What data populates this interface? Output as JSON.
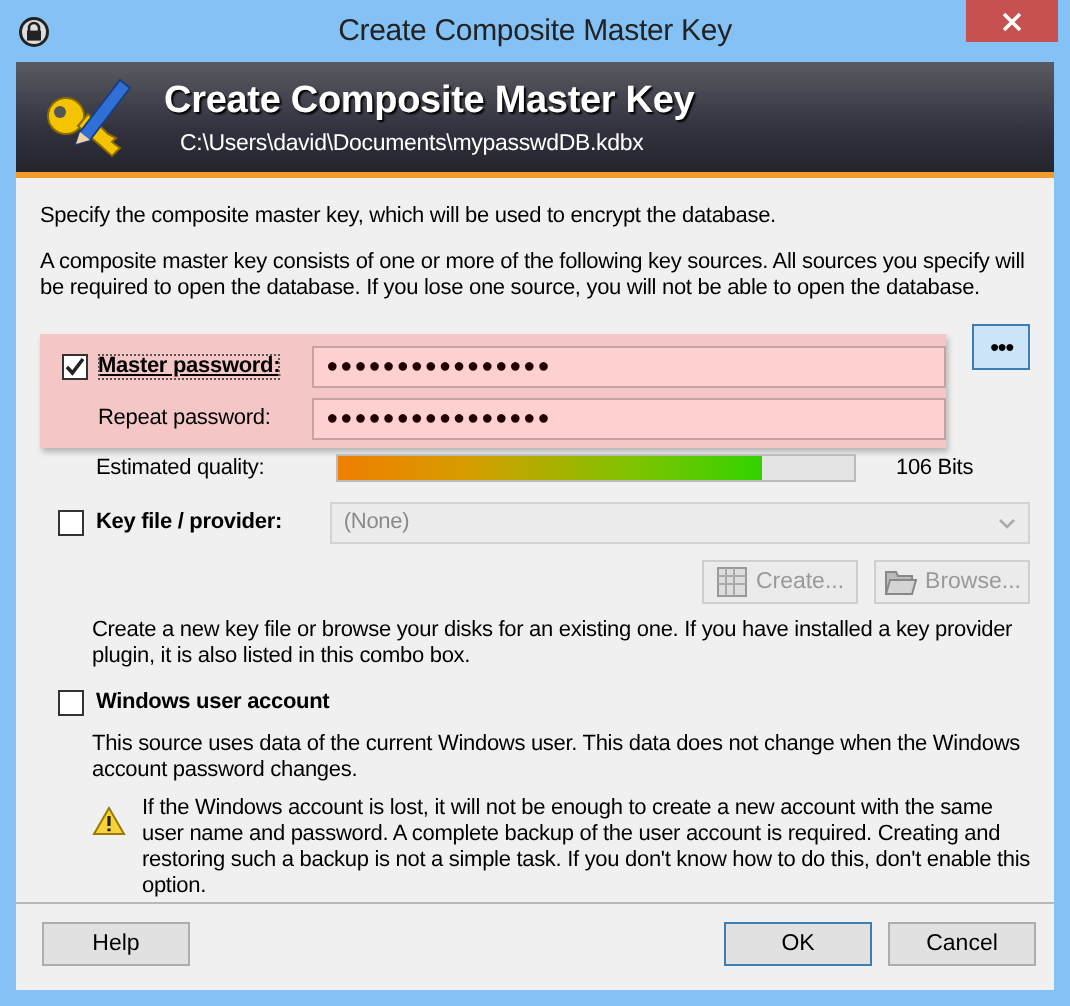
{
  "window": {
    "title": "Create Composite Master Key"
  },
  "banner": {
    "title": "Create Composite Master Key",
    "path": "C:\\Users\\david\\Documents\\mypasswdDB.kdbx"
  },
  "intro": [
    "Specify the composite master key, which will be used to encrypt the database.",
    "A composite master key consists of one or more of the following key sources. All sources you specify will be required to open the database.  If you lose one source, you will not be able to open the database."
  ],
  "master_password": {
    "checked": true,
    "label": "Master password:",
    "value": "●●●●●●●●●●●●●●●●",
    "reveal_button": "●●●",
    "repeat_label": "Repeat password:",
    "repeat_value": "●●●●●●●●●●●●●●●●",
    "quality_label": "Estimated quality:",
    "level": 0.82,
    "quality_reading": "106 Bits"
  },
  "key_file": {
    "checked": false,
    "label": "Key file / provider:",
    "selection": "(None)",
    "combo_disabled": true,
    "buttons": [
      {
        "label": "Create...",
        "kind": "create",
        "disabled": true
      },
      {
        "label": "Browse...",
        "kind": "browse",
        "disabled": true
      }
    ],
    "description": "Create a new key file or browse your disks for an existing one. If you have installed a key provider plugin, it is also listed in this combo box."
  },
  "windows_account": {
    "checked": false,
    "label": "Windows user account",
    "description": "This source uses data of the current Windows user. This data does not change when the Windows account password changes.",
    "warning": "If the Windows account is lost, it will not be enough to create a new account with the same user name and password. A complete backup of the user account is required. Creating and restoring such a backup is not a simple task. If you don't know how to do this, don't enable this option."
  },
  "buttons": [
    {
      "label": "Help",
      "default": false
    },
    {
      "label": "OK",
      "default": true
    },
    {
      "label": "Cancel",
      "default": false
    }
  ]
}
